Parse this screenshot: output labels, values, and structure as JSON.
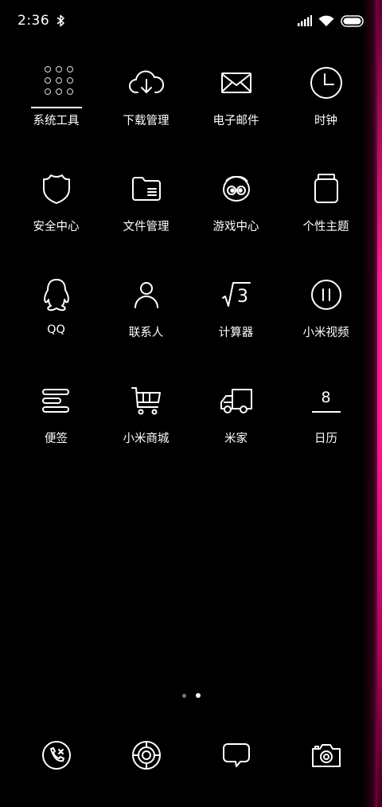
{
  "status_bar": {
    "time": "2:36",
    "icons": [
      "bluetooth-icon",
      "signal-icon",
      "wifi-icon",
      "battery-icon"
    ]
  },
  "apps": [
    {
      "label": "系统工具",
      "icon": "system-tools-icon"
    },
    {
      "label": "下载管理",
      "icon": "cloud-download-icon"
    },
    {
      "label": "电子邮件",
      "icon": "mail-icon"
    },
    {
      "label": "时钟",
      "icon": "clock-icon"
    },
    {
      "label": "安全中心",
      "icon": "shield-icon"
    },
    {
      "label": "文件管理",
      "icon": "folder-icon"
    },
    {
      "label": "游戏中心",
      "icon": "game-face-icon"
    },
    {
      "label": "个性主题",
      "icon": "theme-jar-icon"
    },
    {
      "label": "QQ",
      "icon": "qq-penguin-icon"
    },
    {
      "label": "联系人",
      "icon": "person-icon"
    },
    {
      "label": "计算器",
      "icon": "calculator-icon"
    },
    {
      "label": "小米视频",
      "icon": "pause-circle-icon"
    },
    {
      "label": "便签",
      "icon": "notes-icon"
    },
    {
      "label": "小米商城",
      "icon": "cart-icon"
    },
    {
      "label": "米家",
      "icon": "truck-icon"
    },
    {
      "label": "日历",
      "icon": "calendar-icon"
    }
  ],
  "calendar_day": "8",
  "calculator_glyph": "3",
  "page_indicator": {
    "count": 2,
    "active": 1
  },
  "dock": [
    {
      "icon": "phone-icon"
    },
    {
      "icon": "browser-icon"
    },
    {
      "icon": "message-icon"
    },
    {
      "icon": "camera-icon"
    }
  ],
  "colors": {
    "background": "#000000",
    "foreground": "#ffffff",
    "edge_glow": "#ff1493"
  }
}
